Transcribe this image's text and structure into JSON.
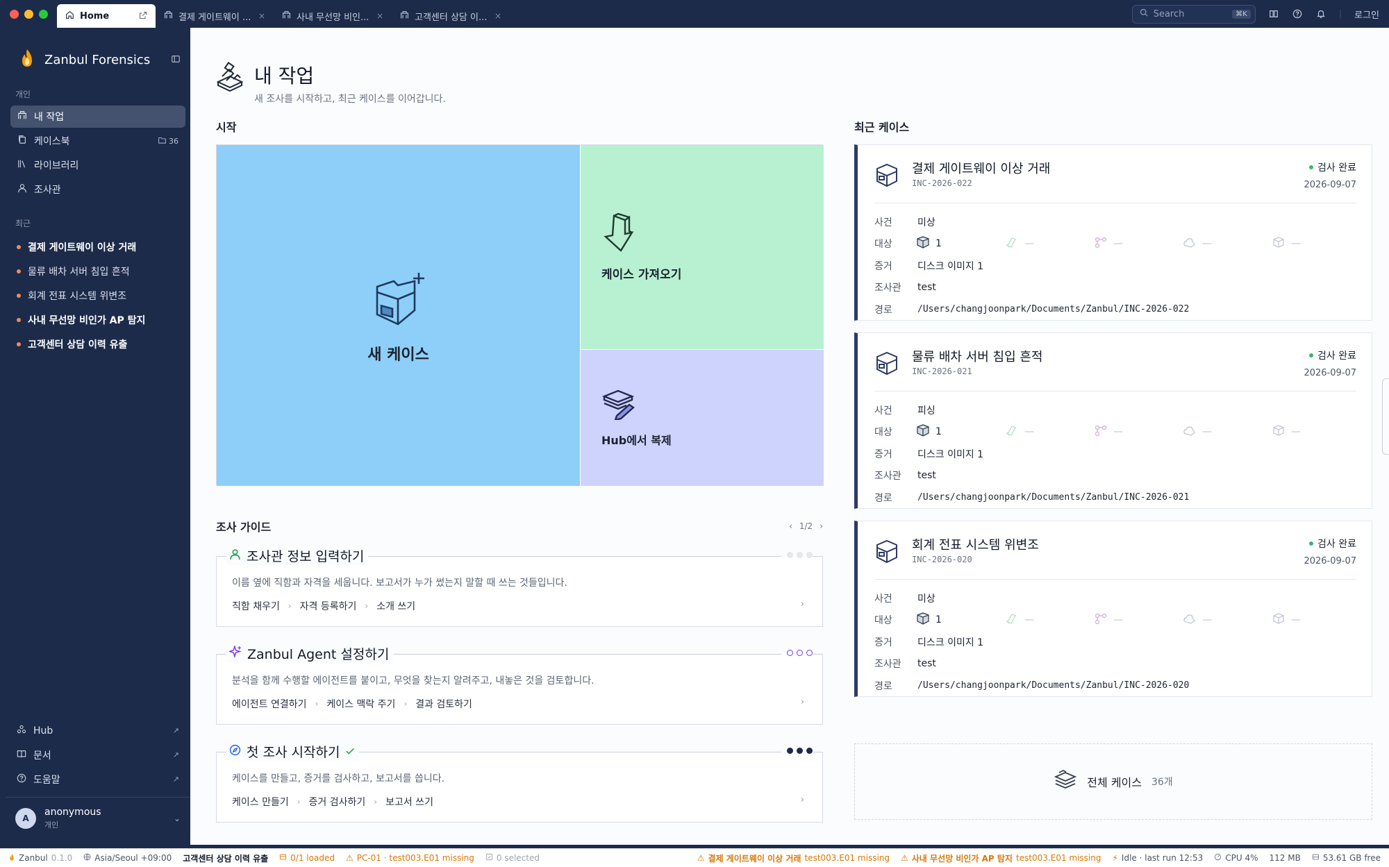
{
  "titlebar": {
    "tabs": [
      {
        "label": "Home",
        "active": true
      },
      {
        "label": "결제 게이트웨이 ..."
      },
      {
        "label": "사내 무선망 비인..."
      },
      {
        "label": "고객센터 상담 이..."
      }
    ],
    "search_placeholder": "Search",
    "search_shortcut": "⌘K",
    "login": "로그인"
  },
  "sidebar": {
    "brand": "Zanbul Forensics",
    "section_personal": "개인",
    "items": [
      {
        "label": "내 작업",
        "active": true
      },
      {
        "label": "케이스북",
        "count": "36"
      },
      {
        "label": "라이브러리"
      },
      {
        "label": "조사관"
      }
    ],
    "section_recent": "최근",
    "recent": [
      {
        "label": "결제 게이트웨이 이상 거래",
        "bold": true
      },
      {
        "label": "물류 배차 서버 침입 흔적"
      },
      {
        "label": "회계 전표 시스템 위변조"
      },
      {
        "label": "사내 무선망 비인가 AP 탐지",
        "bold": true
      },
      {
        "label": "고객센터 상담 이력 유출",
        "bold": true
      }
    ],
    "links": [
      {
        "label": "Hub"
      },
      {
        "label": "문서"
      },
      {
        "label": "도움말"
      }
    ],
    "user": {
      "initial": "A",
      "name": "anonymous",
      "role": "개인"
    }
  },
  "main": {
    "title": "내 작업",
    "subtitle": "새 조사를 시작하고, 최근 케이스를 이어갑니다.",
    "start_title": "시작",
    "tiles": {
      "new_case": "새 케이스",
      "import_case": "케이스 가져오기",
      "hub_clone": "Hub에서 복제"
    },
    "guide_title": "조사 가이드",
    "guide_page": "1/2",
    "guides": [
      {
        "title": "조사관 정보 입력하기",
        "desc": "이름 옆에 직함과 자격을 세웁니다. 보고서가 누가 썼는지 말할 때 쓰는 것들입니다.",
        "steps": [
          "직함 채우기",
          "자격 등록하기",
          "소개 쓰기"
        ],
        "done": false
      },
      {
        "title": "Zanbul Agent 설정하기",
        "desc": "분석을 함께 수행할 에이전트를 붙이고, 무엇을 찾는지 알려주고, 내놓은 것을 검토합니다.",
        "steps": [
          "에이전트 연결하기",
          "케이스 맥락 주기",
          "결과 검토하기"
        ],
        "done": false
      },
      {
        "title": "첫 조사 시작하기",
        "desc": "케이스를 만들고, 증거를 검사하고, 보고서를 씁니다.",
        "steps": [
          "케이스 만들기",
          "증거 검사하기",
          "보고서 쓰기"
        ],
        "done": true
      }
    ],
    "recent_title": "최근 케이스",
    "labels": {
      "incident": "사건",
      "target": "대상",
      "evidence": "증거",
      "investigator": "조사관",
      "path": "경로"
    },
    "cases": [
      {
        "name": "결제 게이트웨이 이상 거래",
        "id": "INC-2026-022",
        "status": "검사 완료",
        "date": "2026-09-07",
        "incident": "미상",
        "target_count": "1",
        "dash": "—",
        "evidence": "디스크 이미지 1",
        "investigator": "test",
        "path": "/Users/changjoonpark/Documents/Zanbul/INC-2026-022"
      },
      {
        "name": "물류 배차 서버 침입 흔적",
        "id": "INC-2026-021",
        "status": "검사 완료",
        "date": "2026-09-07",
        "incident": "피싱",
        "target_count": "1",
        "dash": "—",
        "evidence": "디스크 이미지 1",
        "investigator": "test",
        "path": "/Users/changjoonpark/Documents/Zanbul/INC-2026-021"
      },
      {
        "name": "회계 전표 시스템 위변조",
        "id": "INC-2026-020",
        "status": "검사 완료",
        "date": "2026-09-07",
        "incident": "미상",
        "target_count": "1",
        "dash": "—",
        "evidence": "디스크 이미지 1",
        "investigator": "test",
        "path": "/Users/changjoonpark/Documents/Zanbul/INC-2026-020"
      }
    ],
    "all_cases": {
      "label": "전체 케이스",
      "count": "36개"
    }
  },
  "statusbar": {
    "app": "Zanbul",
    "version": "0.1.0",
    "timezone": "Asia/Seoul +09:00",
    "current_case": "고객센터 상담 이력 유출",
    "loaded": "0/1 loaded",
    "missing": "PC-01 · test003.E01 missing",
    "selected": "0 selected",
    "warn1_case": "결제 게이트웨이 이상 거래",
    "warn1_msg": "test003.E01 missing",
    "warn2_case": "사내 무선망 비인가 AP 탐지",
    "warn2_msg": "test003.E01 missing",
    "idle": "Idle · last run 12:53",
    "cpu": "CPU 4%",
    "mem": "112 MB",
    "disk": "53.61 GB free"
  },
  "colors": {
    "tile_new": "#8dcff8",
    "tile_import": "#b7f1d1",
    "tile_hub": "#cdd3fc",
    "accent": "#2d3a63",
    "status_ok": "#3cb371",
    "recent_dot": "#f08a5d",
    "warn": "#d97706"
  }
}
